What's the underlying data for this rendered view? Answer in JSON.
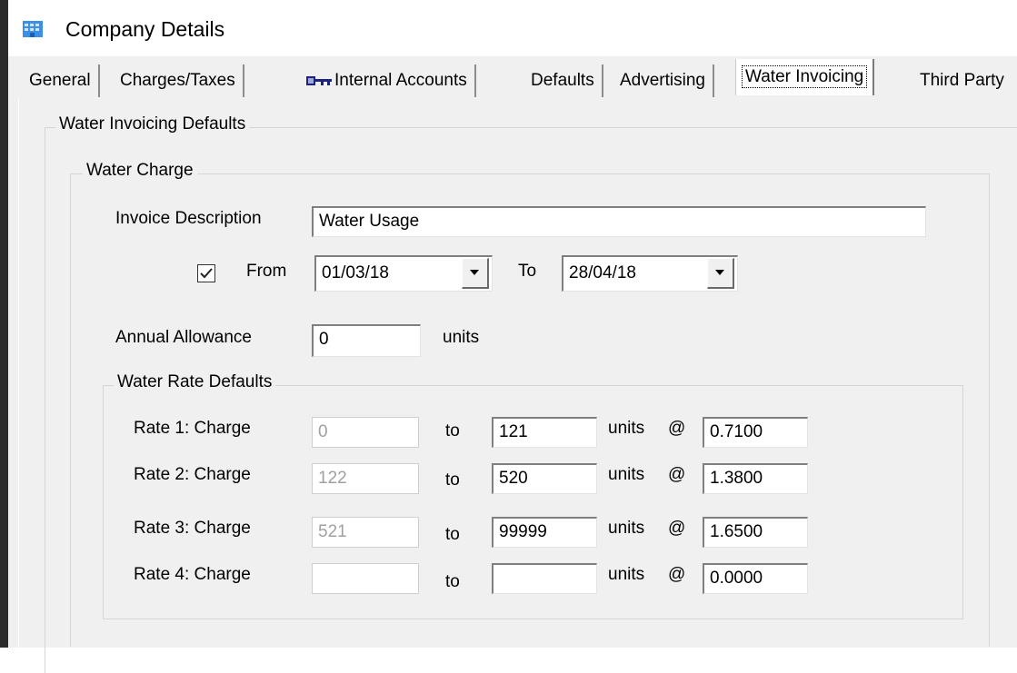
{
  "window": {
    "title": "Company Details"
  },
  "tabs": [
    {
      "label": "General"
    },
    {
      "label": "Charges/Taxes"
    },
    {
      "label": "Internal Accounts"
    },
    {
      "label": "Defaults"
    },
    {
      "label": "Advertising"
    },
    {
      "label": "Water Invoicing",
      "active": true
    },
    {
      "label": "Third Party"
    }
  ],
  "section": {
    "title": "Water Invoicing Defaults",
    "water_charge": {
      "title": "Water Charge",
      "invoice_description_label": "Invoice Description",
      "invoice_description_value": "Water Usage",
      "from_checked": true,
      "from_label": "From",
      "from_value": "01/03/18",
      "to_label": "To",
      "to_value": "28/04/18",
      "annual_allowance_label": "Annual Allowance",
      "annual_allowance_value": "0",
      "annual_allowance_units": "units"
    },
    "rates": {
      "title": "Water Rate Defaults",
      "rows": [
        {
          "label": "Rate 1: Charge",
          "from": "0",
          "to_label": "to",
          "to": "121",
          "units": "units",
          "at": "@",
          "rate": "0.7100"
        },
        {
          "label": "Rate 2: Charge",
          "from": "122",
          "to_label": "to",
          "to": "520",
          "units": "units",
          "at": "@",
          "rate": "1.3800"
        },
        {
          "label": "Rate 3: Charge",
          "from": "521",
          "to_label": "to",
          "to": "99999",
          "units": "units",
          "at": "@",
          "rate": "1.6500"
        },
        {
          "label": "Rate 4: Charge",
          "from": "",
          "to_label": "to",
          "to": "",
          "units": "units",
          "at": "@",
          "rate": "0.0000"
        }
      ]
    }
  },
  "colors": {
    "window_bg": "#f0f0f0",
    "border": "#d5d5d5"
  }
}
